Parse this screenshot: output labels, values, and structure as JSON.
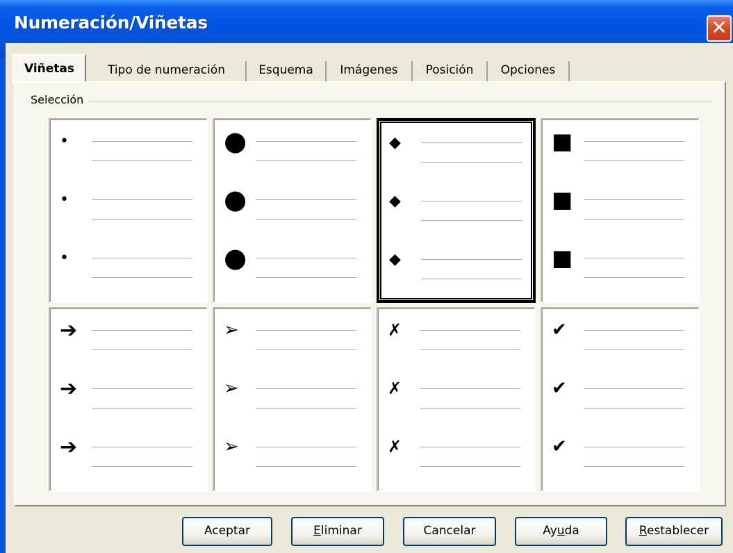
{
  "window": {
    "title": "Numeración/Viñetas",
    "close_glyph": "✕"
  },
  "tabs": [
    {
      "label": "Viñetas",
      "active": true
    },
    {
      "label": "Tipo de numeración",
      "active": false
    },
    {
      "label": "Esquema",
      "active": false
    },
    {
      "label": "Imágenes",
      "active": false
    },
    {
      "label": "Posición",
      "active": false
    },
    {
      "label": "Opciones",
      "active": false
    }
  ],
  "selection": {
    "label": "Selección",
    "selected_index": 2,
    "cells": [
      {
        "name": "small-dot-bullet",
        "symbol": "•"
      },
      {
        "name": "large-circle-bullet",
        "symbol": "●"
      },
      {
        "name": "diamond-bullet",
        "symbol": "◆"
      },
      {
        "name": "square-bullet",
        "symbol": "■"
      },
      {
        "name": "arrow-bullet",
        "symbol": "➔"
      },
      {
        "name": "arrowhead-bullet",
        "symbol": "➢"
      },
      {
        "name": "x-mark-bullet",
        "symbol": "✗"
      },
      {
        "name": "check-mark-bullet",
        "symbol": "✔"
      }
    ]
  },
  "buttons": {
    "ok": {
      "label": "Aceptar"
    },
    "delete": {
      "prefix": "",
      "mnemonic": "E",
      "suffix": "liminar"
    },
    "cancel": {
      "label": "Cancelar"
    },
    "help": {
      "prefix": "Ay",
      "mnemonic": "u",
      "suffix": "da"
    },
    "reset": {
      "prefix": "",
      "mnemonic": "R",
      "suffix": "establecer"
    }
  }
}
